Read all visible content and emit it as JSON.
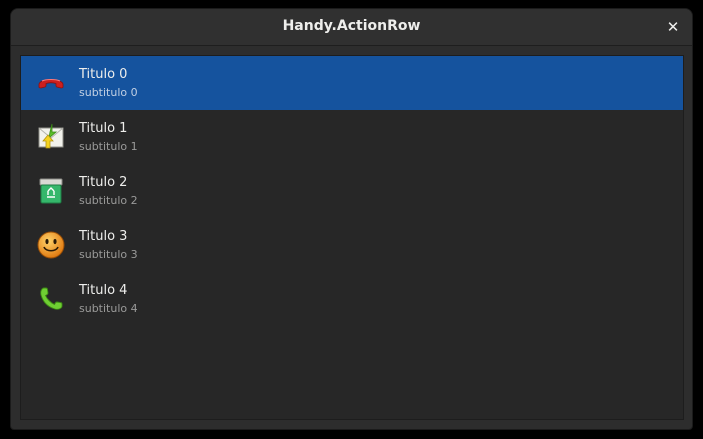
{
  "window": {
    "title": "Handy.ActionRow",
    "close_label": "✕"
  },
  "rows": [
    {
      "title": "Titulo 0",
      "subtitle": "subtitulo 0",
      "icon": "call-stop-icon",
      "selected": true
    },
    {
      "title": "Titulo 1",
      "subtitle": "subtitulo 1",
      "icon": "mail-send-receive-icon",
      "selected": false
    },
    {
      "title": "Titulo 2",
      "subtitle": "subtitulo 2",
      "icon": "user-trash-icon",
      "selected": false
    },
    {
      "title": "Titulo 3",
      "subtitle": "subtitulo 3",
      "icon": "face-smile-icon",
      "selected": false
    },
    {
      "title": "Titulo 4",
      "subtitle": "subtitulo 4",
      "icon": "call-start-icon",
      "selected": false
    }
  ],
  "colors": {
    "selection": "#15539e",
    "background": "#2d2d2d"
  }
}
